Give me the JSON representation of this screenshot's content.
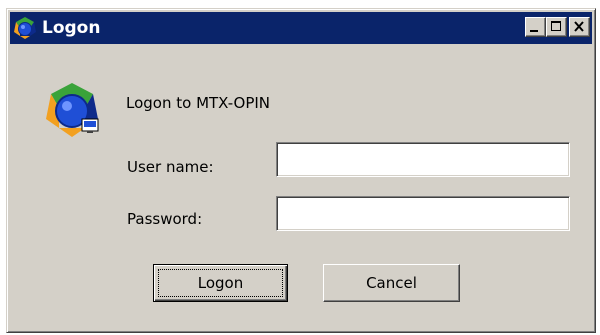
{
  "window": {
    "title": "Logon",
    "title_icon": "app-logo-icon",
    "controls": {
      "minimize_icon": "minimize-icon",
      "maximize_icon": "maximize-icon",
      "close_icon": "close-icon"
    }
  },
  "dialog": {
    "icon": "network-logon-icon",
    "heading": "Logon to MTX-OPIN",
    "username": {
      "label": "User name:",
      "value": "",
      "placeholder": ""
    },
    "password": {
      "label": "Password:",
      "value": "",
      "placeholder": ""
    },
    "buttons": {
      "logon": "Logon",
      "cancel": "Cancel"
    }
  },
  "colors": {
    "titlebar": "#0a246a",
    "face": "#d4d0c8",
    "icon_blue": "#1f4fd6",
    "icon_orange": "#f2a020",
    "icon_green": "#3aa33a",
    "icon_navy": "#0d2a8a"
  }
}
